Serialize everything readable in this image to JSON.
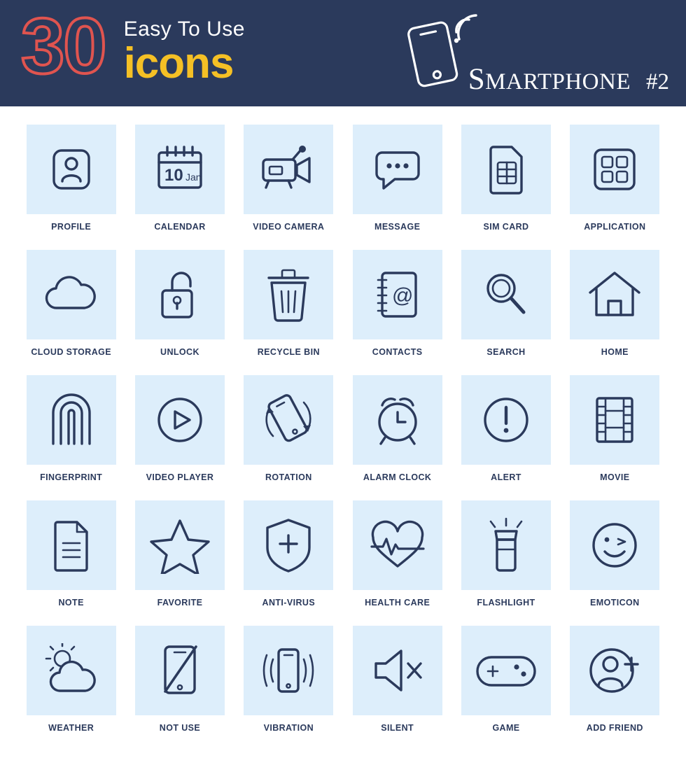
{
  "header": {
    "count": "30",
    "tagline": "Easy To Use",
    "icons_word": "icons",
    "category_first_letter": "S",
    "category_rest": "MARTPHONE",
    "category_number": "#2",
    "colors": {
      "background": "#2b3a5c",
      "number_outline": "#e0544f",
      "icons_word": "#f5c025",
      "text": "#ffffff"
    }
  },
  "grid": {
    "columns": 6,
    "tile_background": "#ddeefb",
    "icon_color": "#2b3a5c",
    "items": [
      {
        "label": "PROFILE",
        "icon": "profile-icon"
      },
      {
        "label": "CALENDAR",
        "icon": "calendar-icon",
        "day": "10",
        "month": "Jan"
      },
      {
        "label": "VIDEO CAMERA",
        "icon": "video-camera-icon"
      },
      {
        "label": "MESSAGE",
        "icon": "message-icon"
      },
      {
        "label": "SIM CARD",
        "icon": "sim-card-icon"
      },
      {
        "label": "APPLICATION",
        "icon": "application-icon"
      },
      {
        "label": "CLOUD STORAGE",
        "icon": "cloud-storage-icon"
      },
      {
        "label": "UNLOCK",
        "icon": "unlock-icon"
      },
      {
        "label": "RECYCLE BIN",
        "icon": "recycle-bin-icon"
      },
      {
        "label": "CONTACTS",
        "icon": "contacts-icon"
      },
      {
        "label": "SEARCH",
        "icon": "search-icon"
      },
      {
        "label": "HOME",
        "icon": "home-icon"
      },
      {
        "label": "FINGERPRINT",
        "icon": "fingerprint-icon"
      },
      {
        "label": "VIDEO PLAYER",
        "icon": "video-player-icon"
      },
      {
        "label": "ROTATION",
        "icon": "rotation-icon"
      },
      {
        "label": "ALARM CLOCK",
        "icon": "alarm-clock-icon"
      },
      {
        "label": "ALERT",
        "icon": "alert-icon"
      },
      {
        "label": "MOVIE",
        "icon": "movie-icon"
      },
      {
        "label": "NOTE",
        "icon": "note-icon"
      },
      {
        "label": "FAVORITE",
        "icon": "favorite-icon"
      },
      {
        "label": "ANTI-VIRUS",
        "icon": "anti-virus-icon"
      },
      {
        "label": "HEALTH CARE",
        "icon": "health-care-icon"
      },
      {
        "label": "FLASHLIGHT",
        "icon": "flashlight-icon"
      },
      {
        "label": "EMOTICON",
        "icon": "emoticon-icon"
      },
      {
        "label": "WEATHER",
        "icon": "weather-icon"
      },
      {
        "label": "NOT USE",
        "icon": "not-use-icon"
      },
      {
        "label": "VIBRATION",
        "icon": "vibration-icon"
      },
      {
        "label": "SILENT",
        "icon": "silent-icon"
      },
      {
        "label": "GAME",
        "icon": "game-icon"
      },
      {
        "label": "ADD FRIEND",
        "icon": "add-friend-icon"
      }
    ]
  }
}
